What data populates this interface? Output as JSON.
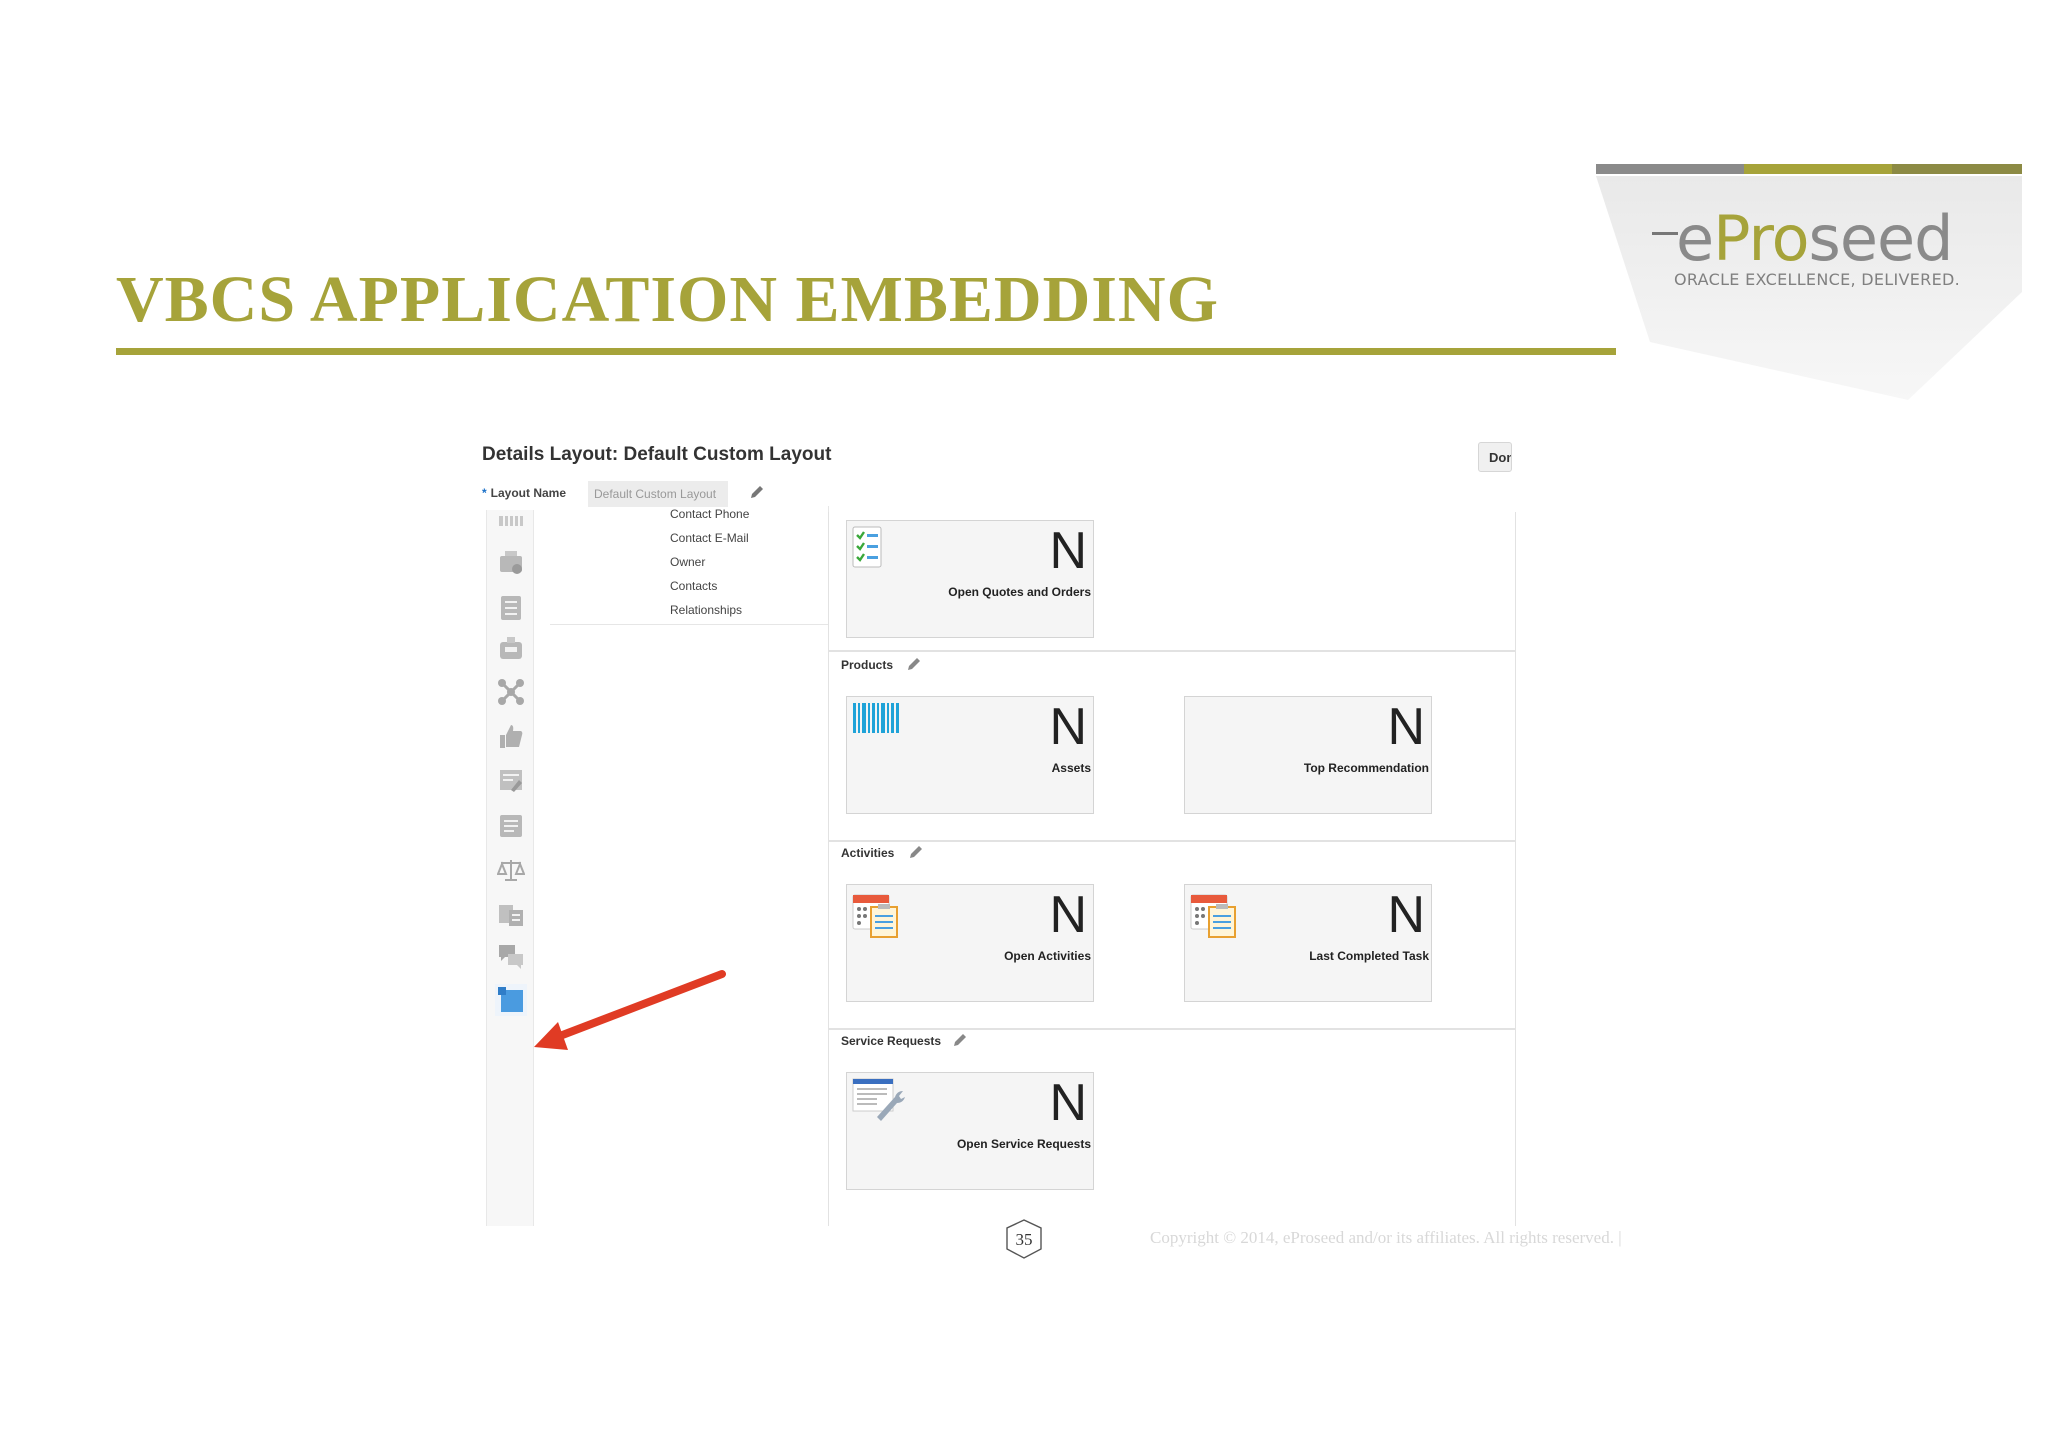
{
  "slide": {
    "title": "VBCS APPLICATION EMBEDDING",
    "logo": {
      "brand_e": "e",
      "brand_pro": "Pro",
      "brand_seed": "seed",
      "tagline": "ORACLE EXCELLENCE, DELIVERED."
    },
    "page_number": "35",
    "copyright": "Copyright © 2014, eProseed and/or its affiliates. All rights reserved.  |"
  },
  "screen": {
    "title": "Details Layout: Default Custom Layout",
    "done_label": "Done",
    "layout_name_label": "Layout Name",
    "layout_name_value": "Default Custom Layout",
    "palette_icons": [
      "barcode-icon",
      "stamp-icon",
      "checklist-icon",
      "briefcase-icon",
      "network-icon",
      "thumbs-up-icon",
      "edit-form-icon",
      "document-icon",
      "scales-icon",
      "calendar-list-icon",
      "chat-icon",
      "application-icon"
    ],
    "fields": [
      "Contact Phone",
      "Contact E-Mail",
      "Owner",
      "Contacts",
      "Relationships"
    ],
    "sections": [
      {
        "label": "",
        "cards": [
          {
            "label": "Open Quotes and Orders",
            "value": "N",
            "icon": "checklist-icon"
          }
        ]
      },
      {
        "label": "Products",
        "cards": [
          {
            "label": "Assets",
            "value": "N",
            "icon": "barcode-icon"
          },
          {
            "label": "Top Recommendation",
            "value": "N",
            "icon": ""
          }
        ]
      },
      {
        "label": "Activities",
        "cards": [
          {
            "label": "Open Activities",
            "value": "N",
            "icon": "calendar-task-icon"
          },
          {
            "label": "Last Completed Task",
            "value": "N",
            "icon": "calendar-task-icon"
          }
        ]
      },
      {
        "label": "Service Requests",
        "cards": [
          {
            "label": "Open Service Requests",
            "value": "N",
            "icon": "service-form-icon"
          }
        ]
      }
    ]
  },
  "colors": {
    "accent": "#a6a33a",
    "arrow": "#e03b24",
    "selected_icon": "#4a9be0"
  }
}
